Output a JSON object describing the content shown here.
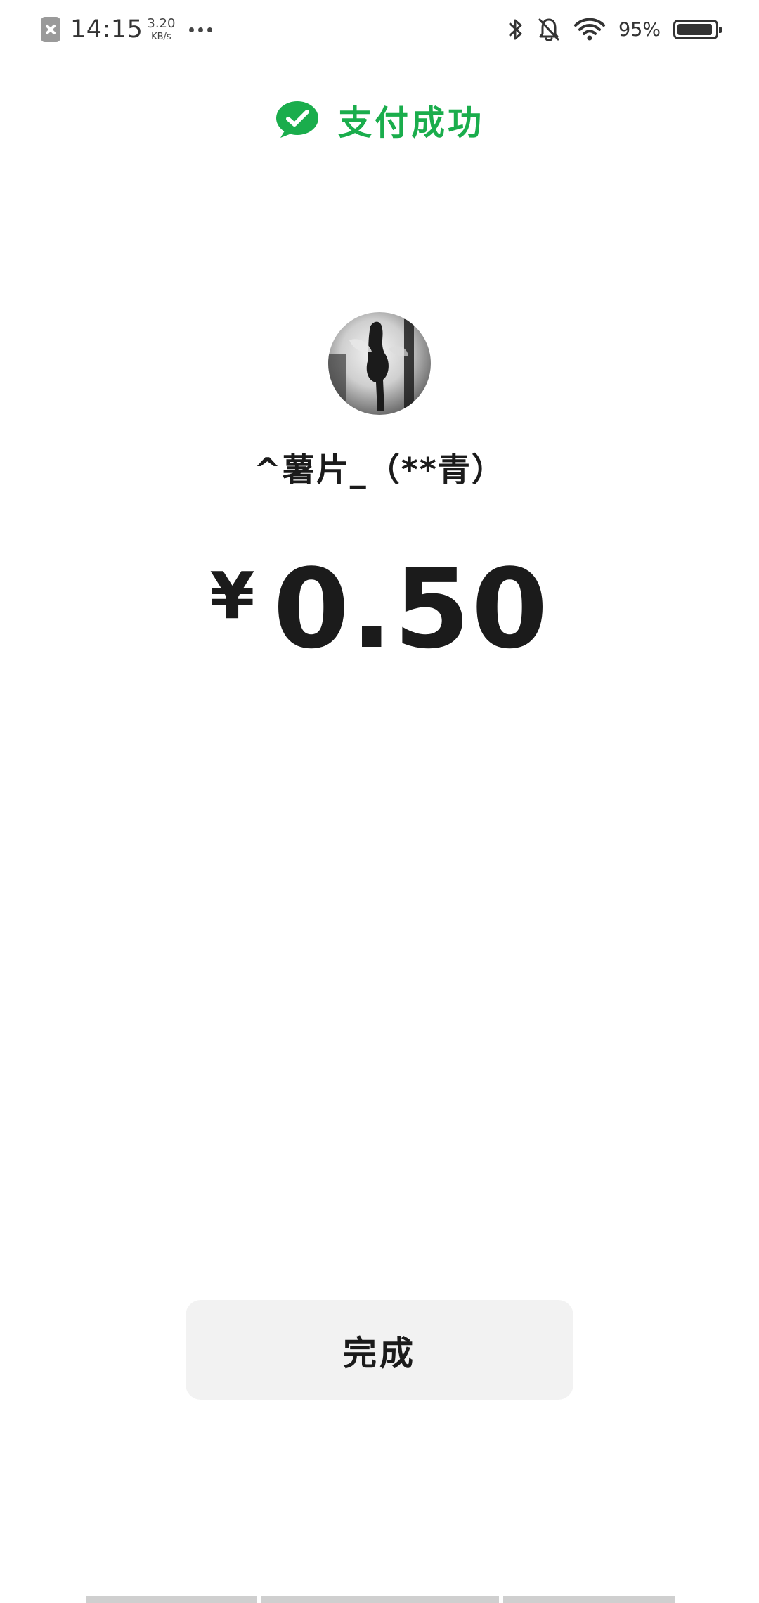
{
  "status_bar": {
    "time": "14:15",
    "net_speed_value": "3.20",
    "net_speed_unit": "KB/s",
    "battery_percent": "95%",
    "battery_level": 0.95
  },
  "header": {
    "title": "支付成功",
    "brand_color": "#1aad4c"
  },
  "payee": {
    "name": "^薯片_（**青）"
  },
  "amount": {
    "currency_symbol": "¥",
    "value": "0.50"
  },
  "actions": {
    "done_label": "完成"
  },
  "icons": {
    "header": "wechat-pay-icon",
    "status": [
      "notification-icon",
      "bluetooth-icon",
      "bell-muted-icon",
      "wifi-icon",
      "battery-icon"
    ]
  }
}
